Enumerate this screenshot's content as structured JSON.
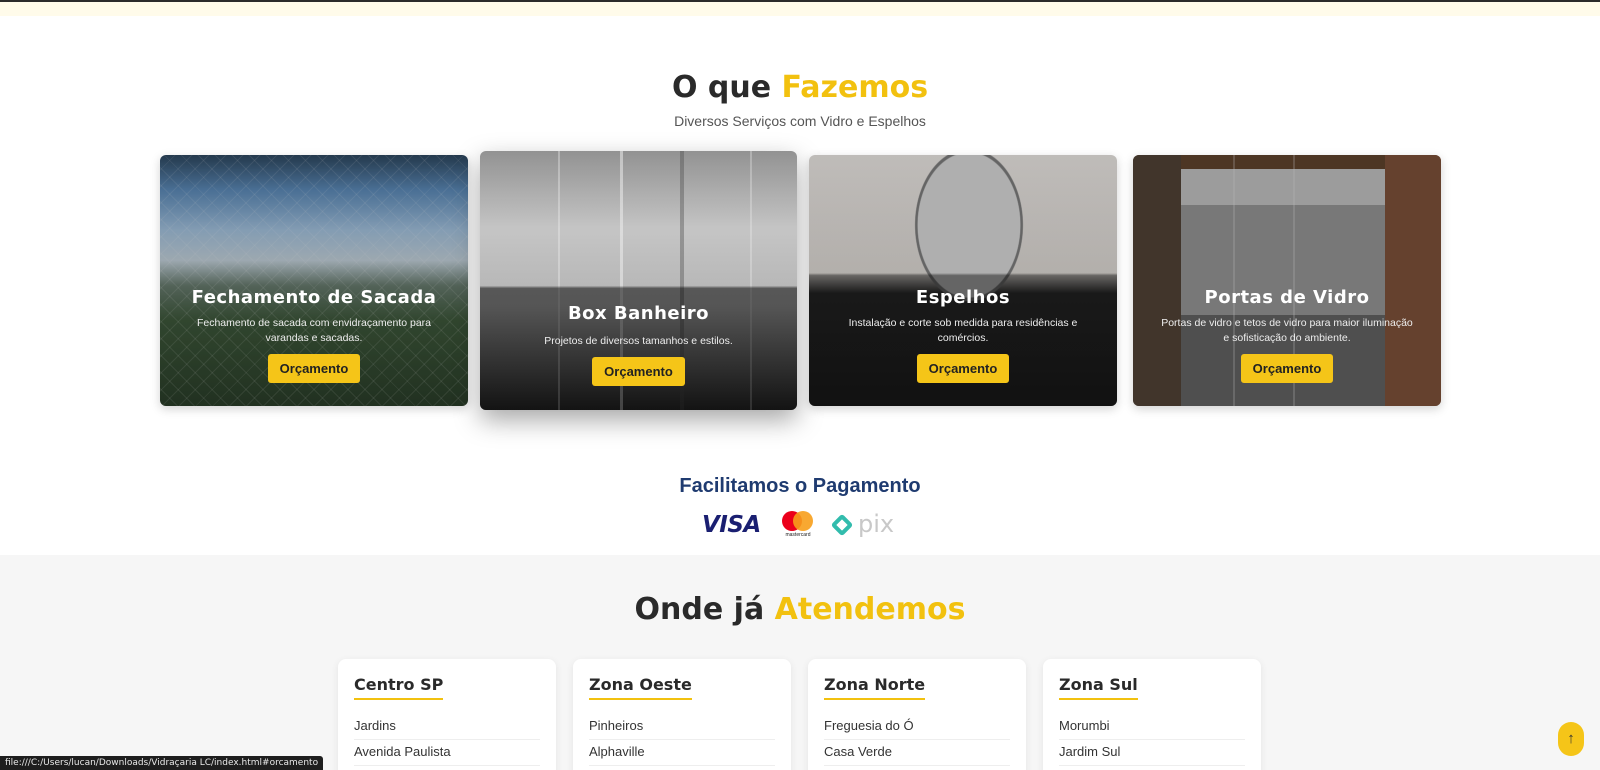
{
  "services": {
    "title_pre": "O que",
    "title_highlight": "Fazemos",
    "subtitle": "Diversos Serviços com Vidro e Espelhos",
    "cards": [
      {
        "title": "Fechamento de Sacada",
        "description": "Fechamento de sacada com envidraçamento para varandas e sacadas.",
        "button": "Orçamento"
      },
      {
        "title": "Box Banheiro",
        "description": "Projetos de diversos tamanhos e estilos.",
        "button": "Orçamento"
      },
      {
        "title": "Espelhos",
        "description": "Instalação e corte sob medida para residências e comércios.",
        "button": "Orçamento"
      },
      {
        "title": "Portas de Vidro",
        "description": "Portas de vidro e tetos de vidro para maior iluminação e sofisticação do ambiente.",
        "button": "Orçamento"
      }
    ]
  },
  "payment": {
    "title": "Facilitamos o Pagamento",
    "methods": [
      "VISA",
      "mastercard",
      "pix"
    ]
  },
  "areas": {
    "title_pre": "Onde já",
    "title_highlight": "Atendemos",
    "regions": [
      {
        "name": "Centro SP",
        "places": [
          "Jardins",
          "Avenida Paulista"
        ]
      },
      {
        "name": "Zona Oeste",
        "places": [
          "Pinheiros",
          "Alphaville"
        ]
      },
      {
        "name": "Zona Norte",
        "places": [
          "Freguesia do Ó",
          "Casa Verde"
        ]
      },
      {
        "name": "Zona Sul",
        "places": [
          "Morumbi",
          "Jardim Sul"
        ]
      }
    ]
  },
  "status_bar": {
    "url": "file:///C:/Users/lucan/Downloads/Vidraçaria LC/index.html#orcamento"
  },
  "scroll_top": {
    "glyph": "↑",
    "icon": "arrow-up-icon"
  },
  "colors": {
    "accent": "#f5c518",
    "heading": "#2a2a2a",
    "payment_title": "#1f3b70",
    "visa": "#1a1f71",
    "pix": "#32bcad"
  }
}
